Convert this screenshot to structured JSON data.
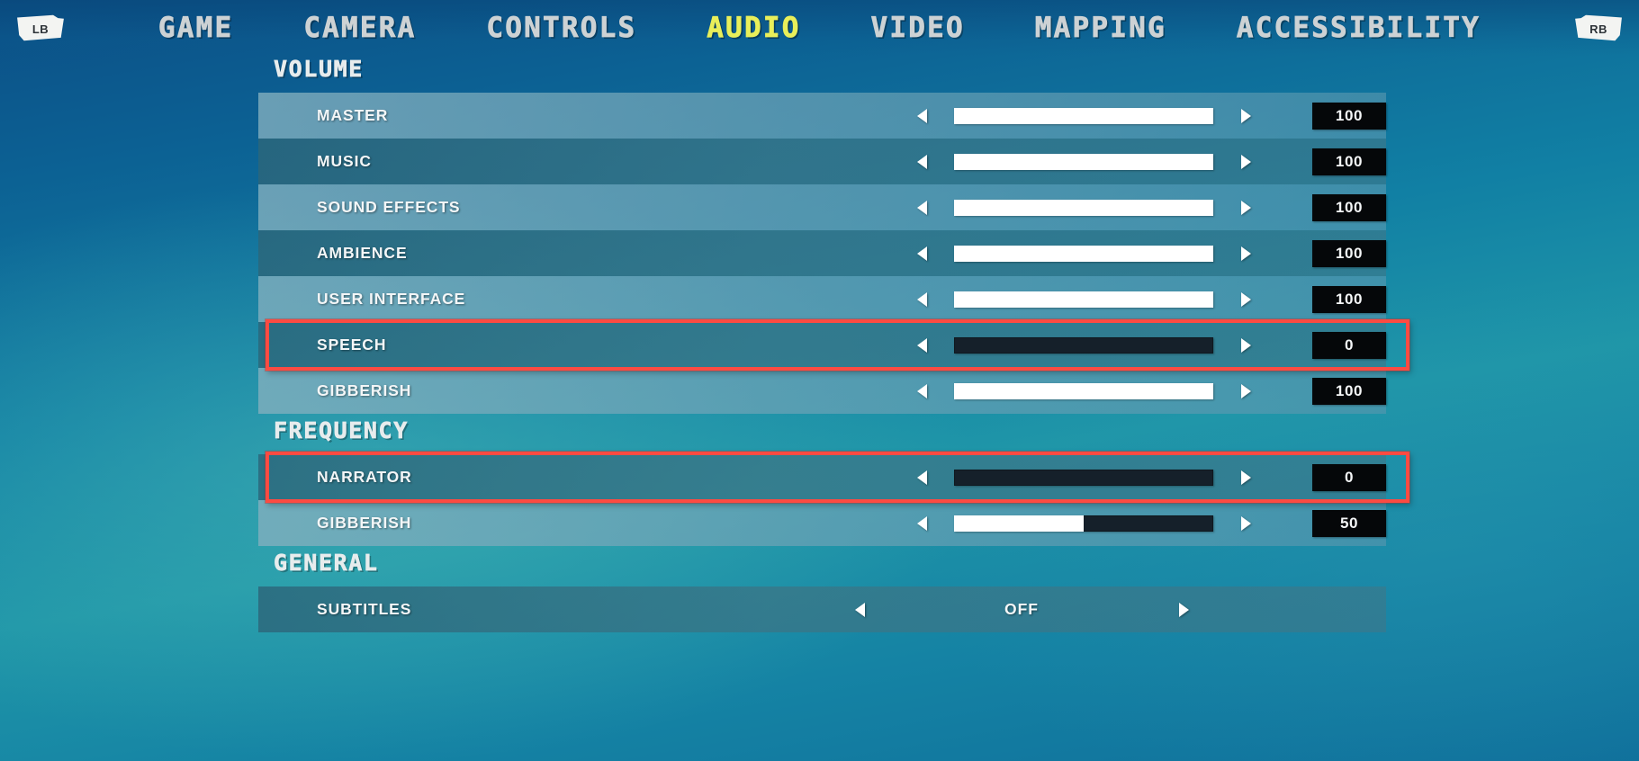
{
  "nav": {
    "left_bumper": {
      "icon": "lb-shoulder-icon",
      "label": "LB"
    },
    "right_bumper": {
      "icon": "rb-shoulder-icon",
      "label": "RB"
    },
    "tabs": [
      {
        "label": "GAME",
        "active": false
      },
      {
        "label": "CAMERA",
        "active": false
      },
      {
        "label": "CONTROLS",
        "active": false
      },
      {
        "label": "AUDIO",
        "active": true
      },
      {
        "label": "VIDEO",
        "active": false
      },
      {
        "label": "MAPPING",
        "active": false
      },
      {
        "label": "ACCESSIBILITY",
        "active": false
      }
    ],
    "active_color": "#e9ef5a",
    "inactive_color": "#cdd2d4"
  },
  "colors": {
    "highlight_border": "#fc4b42",
    "slider_fill": "#ffffff",
    "slider_track": "#15202a",
    "value_box_bg": "#050709",
    "value_text": "#f4f6f7"
  },
  "sections": [
    {
      "title": "VOLUME",
      "rows": [
        {
          "label": "MASTER",
          "type": "slider",
          "value": "100",
          "percent": 100,
          "highlighted": false
        },
        {
          "label": "MUSIC",
          "type": "slider",
          "value": "100",
          "percent": 100,
          "highlighted": false
        },
        {
          "label": "SOUND EFFECTS",
          "type": "slider",
          "value": "100",
          "percent": 100,
          "highlighted": false
        },
        {
          "label": "AMBIENCE",
          "type": "slider",
          "value": "100",
          "percent": 100,
          "highlighted": false
        },
        {
          "label": "USER INTERFACE",
          "type": "slider",
          "value": "100",
          "percent": 100,
          "highlighted": false
        },
        {
          "label": "SPEECH",
          "type": "slider",
          "value": "0",
          "percent": 0,
          "highlighted": true
        },
        {
          "label": "GIBBERISH",
          "type": "slider",
          "value": "100",
          "percent": 100,
          "highlighted": false
        }
      ]
    },
    {
      "title": "FREQUENCY",
      "rows": [
        {
          "label": "NARRATOR",
          "type": "slider",
          "value": "0",
          "percent": 0,
          "highlighted": true
        },
        {
          "label": "GIBBERISH",
          "type": "slider",
          "value": "50",
          "percent": 50,
          "highlighted": false
        }
      ]
    },
    {
      "title": "GENERAL",
      "rows": [
        {
          "label": "SUBTITLES",
          "type": "choice",
          "value": "OFF",
          "highlighted": false
        }
      ]
    }
  ]
}
